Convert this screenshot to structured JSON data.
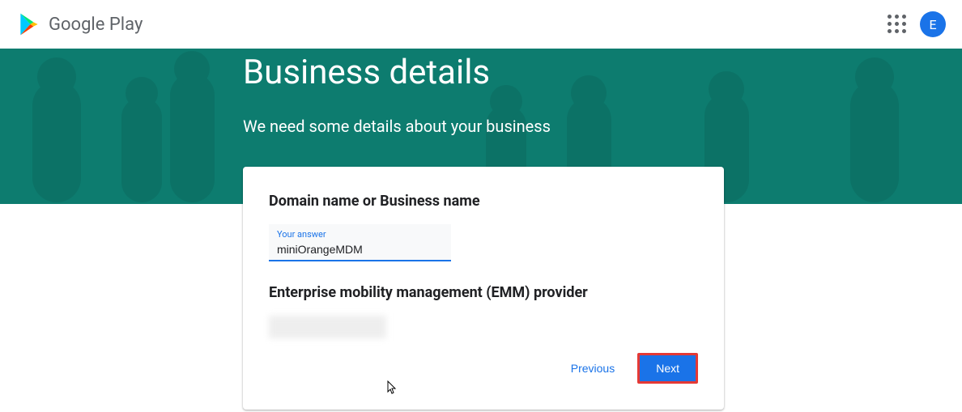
{
  "header": {
    "logo_text": "Google Play",
    "avatar_initial": "E"
  },
  "banner": {
    "title": "Business details",
    "subtitle": "We need some details about your business"
  },
  "form": {
    "domain_label": "Domain name or Business name",
    "input_hint": "Your answer",
    "input_value": "miniOrangeMDM",
    "emm_label": "Enterprise mobility management (EMM) provider",
    "prev_button": "Previous",
    "next_button": "Next"
  }
}
